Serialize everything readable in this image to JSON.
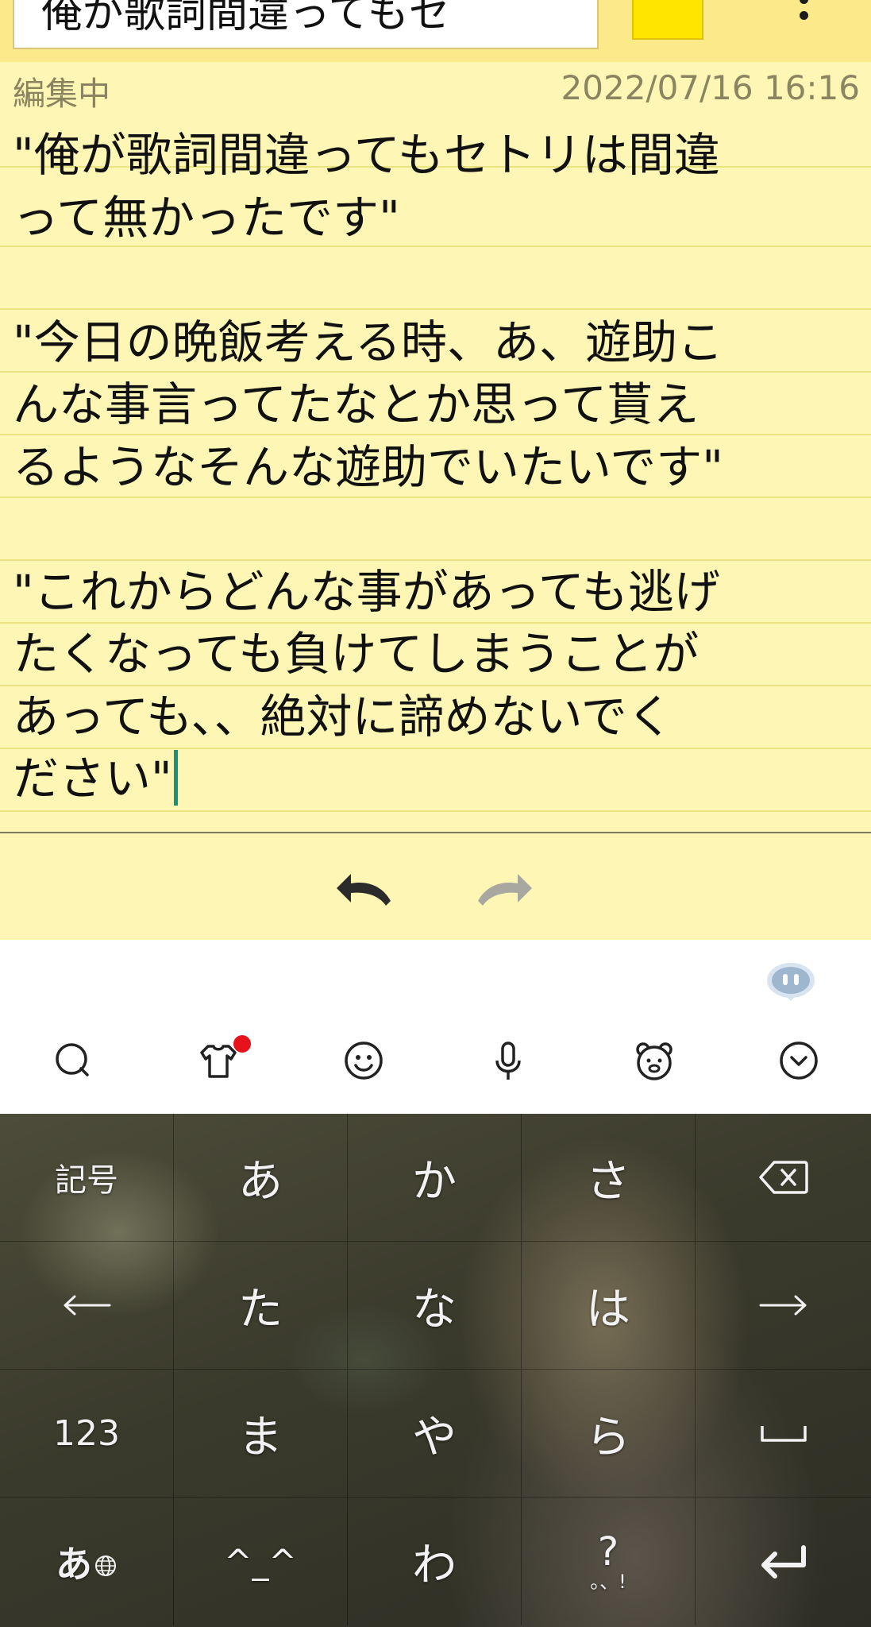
{
  "header": {
    "title": "俺が歌詞間違ってもセ",
    "swatch_color": "#ffe600"
  },
  "status": {
    "editing_label": "編集中",
    "timestamp": "2022/07/16 16:16"
  },
  "memo": {
    "text": "\"俺が歌詞間違ってもセトリは間違\nって無かったです\"\n\n\"今日の晩飯考える時、あ、遊助こ\nんな事言ってたなとか思って貰え\nるようなそんな遊助でいたいです\"\n\n\"これからどんな事があっても逃げ\nたくなっても負けてしまうことが\nあっても、、絶対に諦めないでく\nださい\""
  },
  "toolbar": {
    "icons": [
      "search-icon",
      "theme-shirt-icon",
      "emoji-icon",
      "microphone-icon",
      "kaomoji-bear-icon",
      "collapse-keyboard-icon"
    ],
    "notification_dot_color": "#e8121b"
  },
  "keyboard": {
    "keys": {
      "symbols": "記号",
      "a": "あ",
      "ka": "か",
      "sa": "さ",
      "ta": "た",
      "na": "な",
      "ha": "は",
      "numbers": "123",
      "ma": "ま",
      "ya": "や",
      "ra": "ら",
      "mode": "あ",
      "kaomoji": "^_^",
      "wa": "わ",
      "punct": "?",
      "punct_sub": "。、!"
    }
  }
}
